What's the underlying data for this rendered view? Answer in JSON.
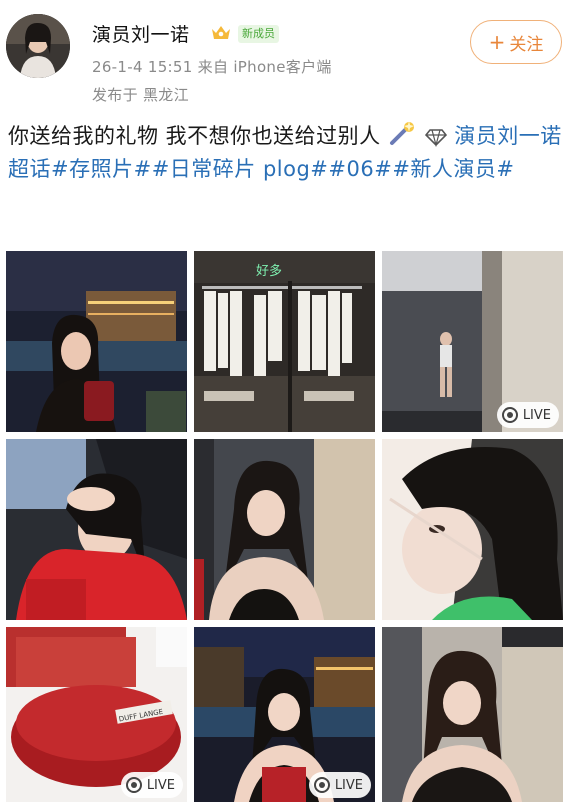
{
  "post": {
    "author": "演员刘一诺",
    "badge": "新成员",
    "follow_label": "关注",
    "follow_plus": "+",
    "meta": "26-1-4 15:51  来自 iPhone客户端",
    "location": "发布于 黑龙江",
    "text_main": "你送给我的礼物 我不想你也送给过别人",
    "tags": "演员刘一诺超话#存照片##日常碎片 plog##06##新人演员#"
  },
  "photos": [
    {
      "name": "photo-1",
      "live": false,
      "live_label": ""
    },
    {
      "name": "photo-2",
      "live": false,
      "live_label": "",
      "overlay_text": "好多👕"
    },
    {
      "name": "photo-3",
      "live": true,
      "live_label": "LIVE"
    },
    {
      "name": "photo-4",
      "live": false,
      "live_label": ""
    },
    {
      "name": "photo-5",
      "live": false,
      "live_label": ""
    },
    {
      "name": "photo-6",
      "live": false,
      "live_label": ""
    },
    {
      "name": "photo-7",
      "live": true,
      "live_label": "LIVE",
      "overlay_text": "DUFF LANGE"
    },
    {
      "name": "photo-8",
      "live": true,
      "live_label": "LIVE"
    },
    {
      "name": "photo-9",
      "live": false,
      "live_label": ""
    }
  ],
  "colors": {
    "tag": "#2a6fb6",
    "follow": "#e8863a",
    "badge_bg": "#e8f6e3",
    "badge_text": "#4aa83a"
  }
}
